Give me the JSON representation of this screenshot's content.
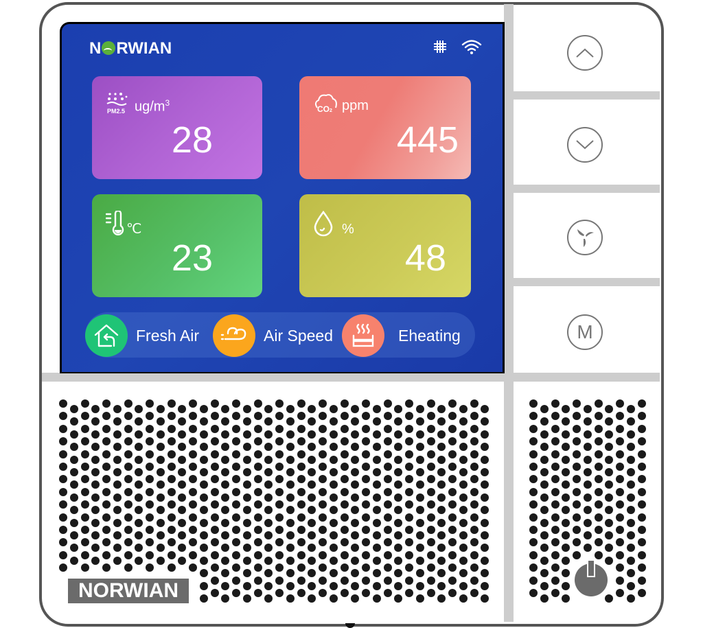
{
  "brand": {
    "name": "NORWIAN",
    "name_left": "N",
    "name_right": "RWIAN"
  },
  "status_bar": {
    "icons": [
      "grid-icon",
      "wifi-icon"
    ]
  },
  "readings": [
    {
      "id": "pm25",
      "icon": "pm25-icon",
      "icon_label": "PM2.5",
      "unit": "ug/m",
      "unit_sup": "3",
      "value": "28",
      "color": "#b063d4"
    },
    {
      "id": "co2",
      "icon": "co2-cloud-icon",
      "icon_label": "CO2",
      "unit": "ppm",
      "value": "445",
      "color": "#ee7c76"
    },
    {
      "id": "temperature",
      "icon": "thermometer-icon",
      "unit": "℃",
      "value": "23",
      "color": "#56c068"
    },
    {
      "id": "humidity",
      "icon": "water-drop-icon",
      "unit": "%",
      "value": "48",
      "color": "#cccb58"
    }
  ],
  "modes": [
    {
      "label": "Fresh Air",
      "icon": "house-return-icon",
      "color": "#1fc476"
    },
    {
      "label": "Air Speed",
      "icon": "wind-icon",
      "color": "#fba61d"
    },
    {
      "label": "Eheating",
      "icon": "heater-icon",
      "color": "#f7826d"
    }
  ],
  "buttons": {
    "up": {
      "icon": "chevron-up-icon"
    },
    "down": {
      "icon": "chevron-down-icon"
    },
    "fan": {
      "icon": "fan-icon"
    },
    "mode": {
      "icon": "mode-icon",
      "label": "M"
    },
    "power": {
      "icon": "power-icon"
    }
  },
  "colors": {
    "screen_bg": "#1f45b3",
    "frame": "#555555",
    "separator": "#cdcdcd",
    "button_stroke": "#777777"
  }
}
